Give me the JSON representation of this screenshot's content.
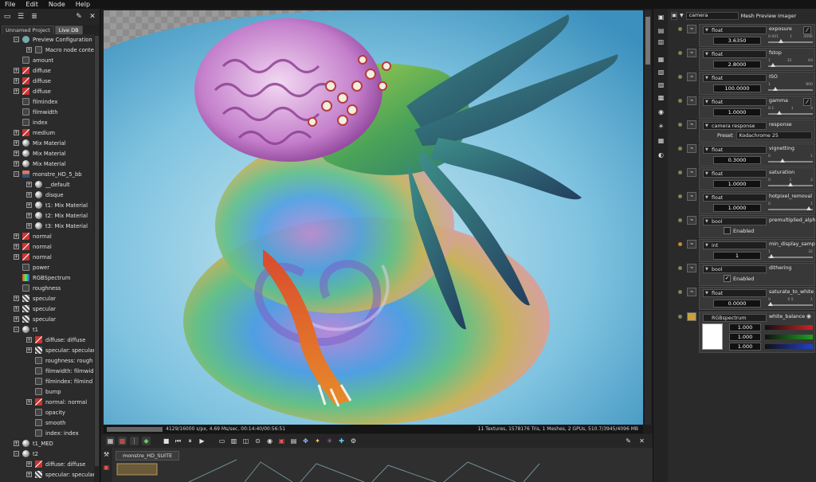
{
  "menu": [
    "File",
    "Edit",
    "Node",
    "Help"
  ],
  "left_tabs": {
    "project": "Unnamed Project",
    "livedb": "Live DB"
  },
  "tree": [
    {
      "label": "Preview Configuration",
      "indent": 1,
      "icon": "cfg",
      "exp": "-"
    },
    {
      "label": "Macro node conte",
      "indent": 2,
      "icon": "float",
      "exp": "+"
    },
    {
      "label": "amount",
      "indent": 1,
      "icon": "float",
      "exp": ""
    },
    {
      "label": "diffuse",
      "indent": 1,
      "icon": "tex",
      "exp": "+"
    },
    {
      "label": "diffuse",
      "indent": 1,
      "icon": "tex",
      "exp": "+"
    },
    {
      "label": "diffuse",
      "indent": 1,
      "icon": "tex",
      "exp": "+"
    },
    {
      "label": "filmindex",
      "indent": 1,
      "icon": "float",
      "exp": ""
    },
    {
      "label": "filmwidth",
      "indent": 1,
      "icon": "float",
      "exp": ""
    },
    {
      "label": "index",
      "indent": 1,
      "icon": "float",
      "exp": ""
    },
    {
      "label": "medium",
      "indent": 1,
      "icon": "tex",
      "exp": "+"
    },
    {
      "label": "Mix Material",
      "indent": 1,
      "icon": "mat",
      "exp": "+"
    },
    {
      "label": "Mix Material",
      "indent": 1,
      "icon": "mat",
      "exp": "+"
    },
    {
      "label": "Mix Material",
      "indent": 1,
      "icon": "mat",
      "exp": "+"
    },
    {
      "label": "monstre_HD_5_bb",
      "indent": 1,
      "icon": "mesh",
      "exp": "-"
    },
    {
      "label": "__default",
      "indent": 2,
      "icon": "mat",
      "exp": "+"
    },
    {
      "label": "disque",
      "indent": 2,
      "icon": "mat",
      "exp": "+"
    },
    {
      "label": "t1: Mix Material",
      "indent": 2,
      "icon": "mat",
      "exp": "+"
    },
    {
      "label": "t2: Mix Material",
      "indent": 2,
      "icon": "mat",
      "exp": "+"
    },
    {
      "label": "t3: Mix Material",
      "indent": 2,
      "icon": "mat",
      "exp": "+"
    },
    {
      "label": "normal",
      "indent": 1,
      "icon": "tex",
      "exp": "+"
    },
    {
      "label": "normal",
      "indent": 1,
      "icon": "tex",
      "exp": "+"
    },
    {
      "label": "normal",
      "indent": 1,
      "icon": "tex",
      "exp": "+"
    },
    {
      "label": "power",
      "indent": 1,
      "icon": "float",
      "exp": ""
    },
    {
      "label": "RGBSpectrum",
      "indent": 1,
      "icon": "rgb",
      "exp": ""
    },
    {
      "label": "roughness",
      "indent": 1,
      "icon": "float",
      "exp": ""
    },
    {
      "label": "specular",
      "indent": 1,
      "icon": "spec",
      "exp": "+"
    },
    {
      "label": "specular",
      "indent": 1,
      "icon": "spec",
      "exp": "+"
    },
    {
      "label": "specular",
      "indent": 1,
      "icon": "spec",
      "exp": "+"
    },
    {
      "label": "t1",
      "indent": 1,
      "icon": "mat",
      "exp": "-"
    },
    {
      "label": "diffuse: diffuse",
      "indent": 2,
      "icon": "tex",
      "exp": "+"
    },
    {
      "label": "specular: specular",
      "indent": 2,
      "icon": "spec",
      "exp": "+"
    },
    {
      "label": "roughness: rough",
      "indent": 2,
      "icon": "float",
      "exp": ""
    },
    {
      "label": "filmwidth: filmwid",
      "indent": 2,
      "icon": "float",
      "exp": ""
    },
    {
      "label": "filmindex: filmind",
      "indent": 2,
      "icon": "float",
      "exp": ""
    },
    {
      "label": "bump",
      "indent": 2,
      "icon": "float",
      "exp": ""
    },
    {
      "label": "normal: normal",
      "indent": 2,
      "icon": "tex",
      "exp": "+"
    },
    {
      "label": "opacity",
      "indent": 2,
      "icon": "float",
      "exp": ""
    },
    {
      "label": "smooth",
      "indent": 2,
      "icon": "float",
      "exp": ""
    },
    {
      "label": "index: index",
      "indent": 2,
      "icon": "float",
      "exp": ""
    },
    {
      "label": "t1_MED",
      "indent": 1,
      "icon": "mat",
      "exp": "+"
    },
    {
      "label": "t2",
      "indent": 1,
      "icon": "mat",
      "exp": "-"
    },
    {
      "label": "diffuse: diffuse",
      "indent": 2,
      "icon": "tex",
      "exp": "+"
    },
    {
      "label": "specular: specular",
      "indent": 2,
      "icon": "spec",
      "exp": "+"
    }
  ],
  "status": {
    "left": "4129/16000 s/px, 4.69 Ms/sec, 00:14:40/00:56:51",
    "right": "11 Textures, 1578176 Tris, 1 Meshes, 2 GPUs, 510.7/3945/4096 MB"
  },
  "graph_tab": "monstre_HD_SUITE",
  "right_header": {
    "camera_combo": "camera",
    "title": "Mesh Preview Imager"
  },
  "params": [
    {
      "type": "float",
      "name": "exposure",
      "value": "3.6350",
      "ticks": [
        "0.001",
        "1",
        "4096"
      ],
      "knob": 0.25,
      "check": true
    },
    {
      "type": "float",
      "name": "fstop",
      "value": "2.8000",
      "ticks": [
        "1",
        "32",
        "64"
      ],
      "knob": 0.05
    },
    {
      "type": "float",
      "name": "ISO",
      "value": "100.0000",
      "ticks": [
        "1",
        "",
        "800"
      ],
      "knob": 0.12
    },
    {
      "type": "float",
      "name": "gamma",
      "value": "1.0000",
      "ticks": [
        "0.1",
        "1",
        "4"
      ],
      "knob": 0.22,
      "check": true
    },
    {
      "type": "camera response",
      "name": "response",
      "preset_label": "Preset",
      "preset": "Kodachrome 25"
    },
    {
      "type": "float",
      "name": "vignetting",
      "value": "0.3000",
      "ticks": [
        "0",
        "",
        "1"
      ],
      "knob": 0.3
    },
    {
      "type": "float",
      "name": "saturation",
      "value": "1.0000",
      "ticks": [
        "0",
        "1",
        "2"
      ],
      "knob": 0.5
    },
    {
      "type": "float",
      "name": "hotpixel_removal",
      "value": "1.0000",
      "ticks": [
        "0",
        "",
        "1"
      ],
      "knob": 0.95
    },
    {
      "type": "bool",
      "name": "premultiplied_alpha",
      "enabled_label": "Enabled",
      "checked": false
    },
    {
      "type": "int",
      "name": "min_display_samples",
      "value": "1",
      "ticks": [
        "1",
        "",
        "32"
      ],
      "knob": 0.02
    },
    {
      "type": "bool",
      "name": "dithering",
      "enabled_label": "Enabled",
      "checked": true
    },
    {
      "type": "float",
      "name": "saturate_to_white",
      "value": "0.0000",
      "ticks": [
        "0",
        "0.5",
        "1"
      ],
      "knob": 0.0
    }
  ],
  "white_balance": {
    "type": "RGBspectrum",
    "name": "white_balance",
    "values": [
      "1.000",
      "1.000",
      "1.000"
    ],
    "bar_colors": [
      "#d02020",
      "#20a020",
      "#2040d0"
    ]
  },
  "icons": {
    "toolbar": [
      "folder-icon",
      "list-icon",
      "graph-icon",
      "wrench-icon",
      "expand-icon"
    ]
  }
}
